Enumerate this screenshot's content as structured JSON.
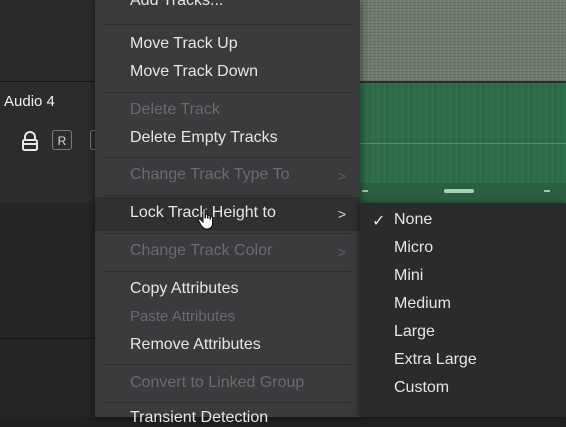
{
  "track_header": {
    "name": "Audio 4",
    "record_button_label": "R"
  },
  "context_menu": {
    "items": [
      {
        "label": "Add Tracks...",
        "enabled": true
      },
      {
        "label": "Move Track Up",
        "enabled": true
      },
      {
        "label": "Move Track Down",
        "enabled": true
      },
      {
        "label": "Delete Track",
        "enabled": false
      },
      {
        "label": "Delete Empty Tracks",
        "enabled": true
      },
      {
        "label": "Change Track Type To",
        "enabled": false,
        "submenu": true
      },
      {
        "label": "Lock Track Height to",
        "enabled": true,
        "submenu": true,
        "highlighted": true
      },
      {
        "label": "Change Track Color",
        "enabled": false,
        "submenu": true
      },
      {
        "label": "Copy Attributes",
        "enabled": true
      },
      {
        "label": "Paste Attributes",
        "enabled": false
      },
      {
        "label": "Remove Attributes",
        "enabled": true
      },
      {
        "label": "Convert to Linked Group",
        "enabled": false
      },
      {
        "label": "Transient Detection",
        "enabled": true
      }
    ],
    "submenu_arrow": ">"
  },
  "height_submenu": {
    "checkmark": "✓",
    "selected": "None",
    "options": [
      "None",
      "Micro",
      "Mini",
      "Medium",
      "Large",
      "Extra Large",
      "Custom"
    ]
  },
  "colors": {
    "menu_bg": "#3a3b3d",
    "audio_clip": "#2b6c45",
    "video_clip": "#6f7c6e",
    "disabled_text": "#6a6b6e"
  }
}
